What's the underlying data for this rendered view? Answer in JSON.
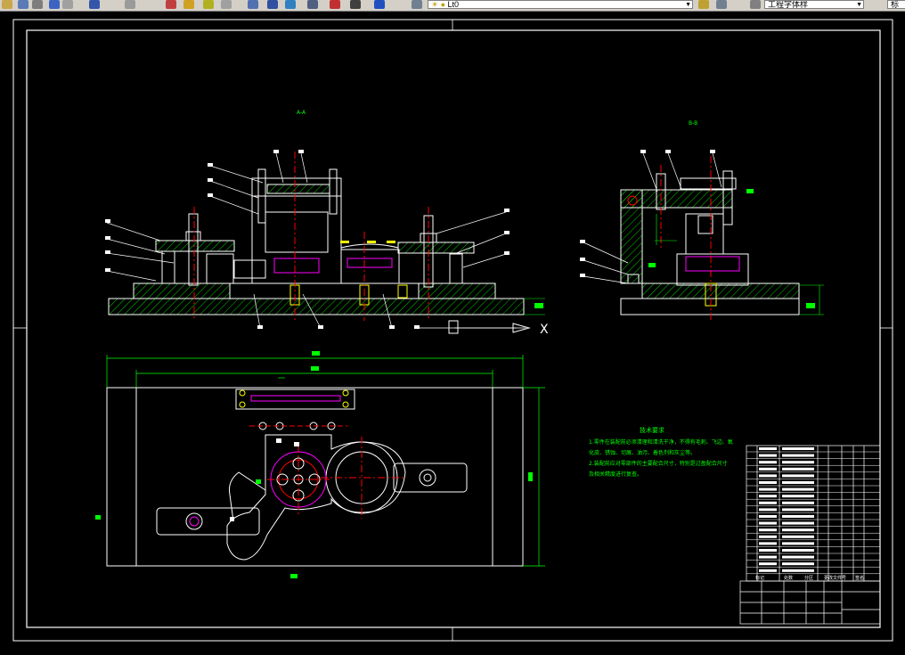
{
  "toolbar": {
    "layer_value": "Lt0",
    "style_value": "工程字体样",
    "right_text": "标"
  },
  "drawing": {
    "section_a_label": "A-A",
    "section_b_label": "B-B",
    "x_marker": "X",
    "tech_title": "技术要求",
    "tech_lines": [
      "1.零件在装配前必须清理和清洗干净，不得有毛刺、飞边、氧",
      "化皮、锈蚀、切屑、油污、着色剂和灰尘等。",
      "2.装配前应对零部件的主要配合尺寸，特别是过盈配合尺寸",
      "及相关精度进行复查。"
    ],
    "title_block_headers": [
      "标记",
      "处数",
      "分区",
      "更改文件号",
      "签名"
    ]
  },
  "colors": {
    "background": "#000000",
    "outline": "#ffffff",
    "dimension": "#00ff00",
    "center_line": "#ff0000",
    "hidden": "#ff00ff",
    "yellow": "#ffff00",
    "cyan": "#00ffff"
  },
  "icons": [
    "open-icon",
    "save-icon",
    "print-icon",
    "undo-icon",
    "zoom-in-icon",
    "zoom-out-icon",
    "properties-icon",
    "layer-icon",
    "style-icon"
  ]
}
